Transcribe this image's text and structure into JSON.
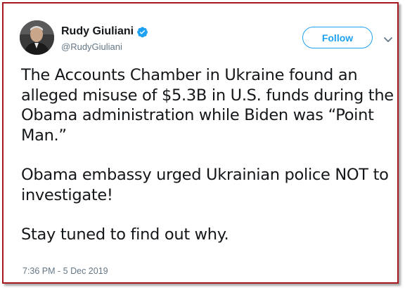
{
  "author": {
    "display_name": "Rudy Giuliani",
    "handle": "@RudyGiuliani",
    "verified": true,
    "avatar_icon": "profile-photo"
  },
  "actions": {
    "follow_label": "Follow",
    "menu_icon": "chevron-down-icon"
  },
  "tweet": {
    "paragraphs": [
      "The Accounts Chamber in Ukraine found an alleged misuse of $5.3B in U.S. funds during the Obama administration while Biden was “Point Man.”",
      "Obama embassy urged Ukrainian police NOT to investigate!",
      "Stay tuned to find out why."
    ],
    "timestamp": "7:36 PM - 5 Dec 2019"
  },
  "colors": {
    "frame_border": "#a51820",
    "accent": "#1da1f2",
    "text": "#14171a",
    "muted": "#657786"
  }
}
